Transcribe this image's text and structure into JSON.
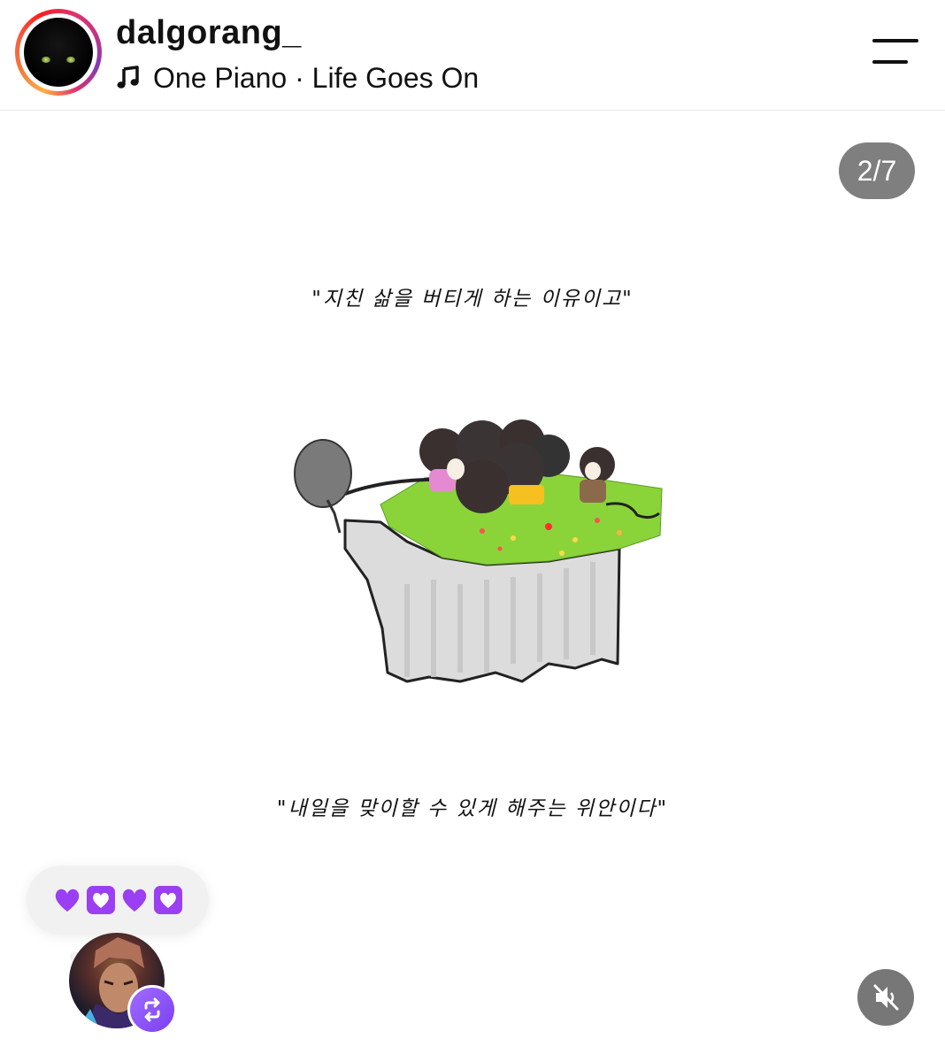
{
  "header": {
    "username": "dalgorang_",
    "music_note_icon": "music-note-icon",
    "song": "One Piano · Life Goes On",
    "menu_icon": "hamburger-menu-icon"
  },
  "story": {
    "counter": "2/7",
    "caption_top": "\"지친 삶을 버티게 하는 이유이고\"",
    "caption_bottom": "\"내일을 맞이할 수 있게 해주는 위안이다\""
  },
  "reactions": {
    "emojis": [
      "💜",
      "💟",
      "💜",
      "💟"
    ],
    "repost_icon": "repost-icon"
  },
  "controls": {
    "mute_icon": "speaker-muted-icon"
  },
  "colors": {
    "badge_purple": "#7b3ff2",
    "cliff_grass": "#8ad43a",
    "counter_bg": "#696969"
  }
}
